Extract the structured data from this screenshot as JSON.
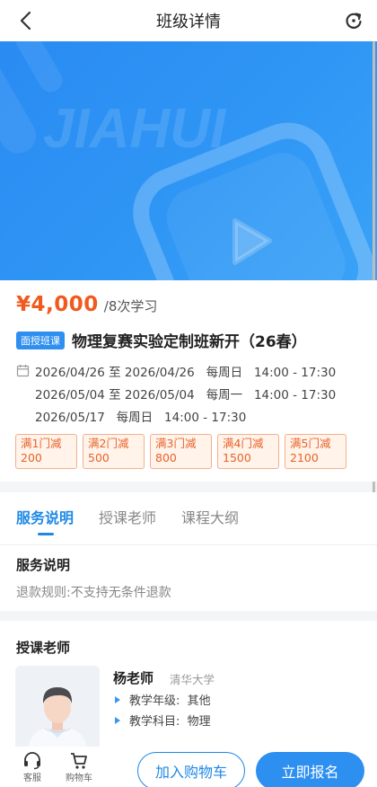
{
  "header": {
    "title": "班级详情"
  },
  "banner": {
    "watermark": "JIAHUI"
  },
  "course": {
    "price": "¥4,000",
    "unit": "/8次学习",
    "badge": "面授班课",
    "title": "物理复赛实验定制班新开（26春）",
    "schedule": [
      "2026/04/26 至 2026/04/26   每周日   14:00 - 17:30",
      "2026/05/04 至 2026/05/04   每周一   14:00 - 17:30",
      "2026/05/17   每周日   14:00 - 17:30"
    ],
    "discounts": [
      {
        "label": "满1门减",
        "amount": "200"
      },
      {
        "label": "满2门减",
        "amount": "500"
      },
      {
        "label": "满3门减",
        "amount": "800"
      },
      {
        "label": "满4门减",
        "amount": "1500"
      },
      {
        "label": "满5门减",
        "amount": "2100"
      }
    ]
  },
  "tabs": [
    {
      "label": "服务说明"
    },
    {
      "label": "授课老师"
    },
    {
      "label": "课程大纲"
    }
  ],
  "service": {
    "title": "服务说明",
    "text": "退款规则:不支持无条件退款"
  },
  "teacher": {
    "section_title": "授课老师",
    "name": "杨老师",
    "school": "清华大学",
    "grade": "教学年级:  其他",
    "subject": "教学科目:  物理"
  },
  "bottom": {
    "service_label": "客服",
    "cart_label": "购物车",
    "add_cart": "加入购物车",
    "signup": "立即报名"
  },
  "colors": {
    "accent": "#1e88e5",
    "price": "#f05a1e",
    "banner": "#2f96f5"
  }
}
